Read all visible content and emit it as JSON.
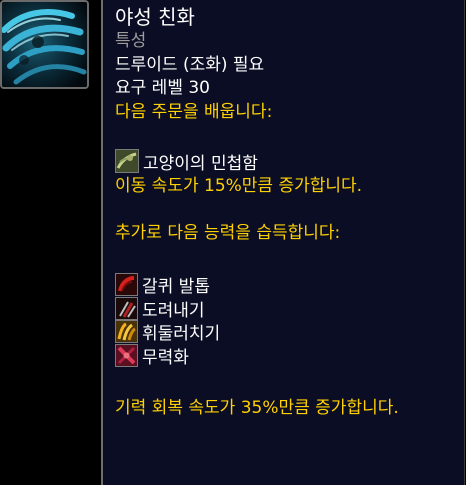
{
  "tooltip": {
    "title": "야성 친화",
    "type": "특성",
    "requirement": "드루이드 (조화) 필요",
    "level": "요구 레벨 30",
    "learn_header": "다음 주문을 배웁니다:",
    "main_spell": {
      "name": "고양이의 민첩함",
      "icon": "cat-agility-icon",
      "effect": "이동 속도가 15%만큼 증가합니다."
    },
    "abilities_header": "추가로 다음 능력을 습득합니다:",
    "abilities": [
      {
        "name": "갈퀴 발톱",
        "icon": "rake-claw-icon"
      },
      {
        "name": "도려내기",
        "icon": "rip-icon"
      },
      {
        "name": "휘둘러치기",
        "icon": "swipe-icon"
      },
      {
        "name": "무력화",
        "icon": "maim-icon"
      }
    ],
    "footer": "기력 회복 속도가 35%만큼 증가합니다."
  },
  "talent_icon": "feral-affinity-claw-icon",
  "colors": {
    "background": "#0a0d24",
    "title": "#ffffff",
    "secondary": "#9d9d9d",
    "highlight": "#ffd100",
    "border": "#6e6e6e"
  }
}
